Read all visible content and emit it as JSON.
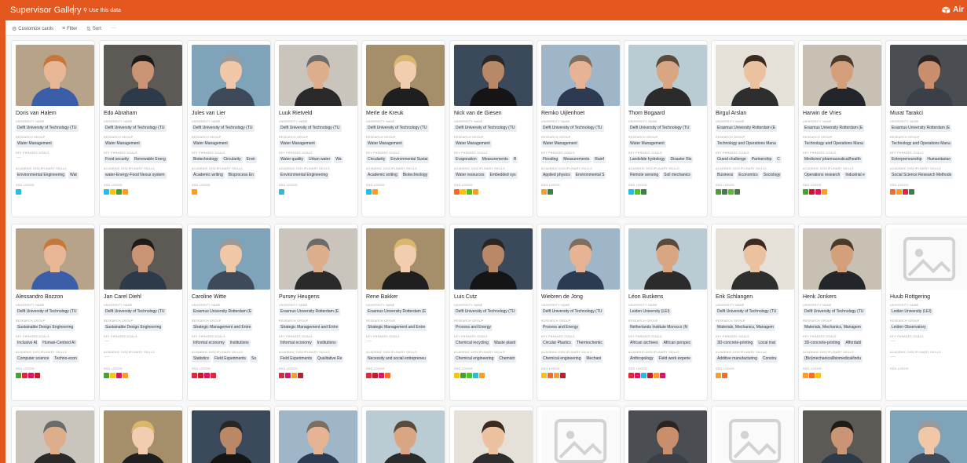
{
  "app": {
    "title": "Supervisor Gallery",
    "use_data": "Use this data",
    "brand": "Air"
  },
  "toolbar": {
    "customize": "Customize cards",
    "filter": "Filter",
    "sort": "Sort",
    "more": "···"
  },
  "labels": {
    "university": "University name",
    "research_group": "Research group",
    "key_phrases": "Key phrases goals",
    "skills": "Academic disciplinary skills",
    "sdg": "SDG logos"
  },
  "colors": {
    "brand": "#e4571f",
    "chip": "#e9eef5"
  },
  "cards": [
    {
      "name": "Doris van Halem",
      "university": "Delft University of Technology (TU",
      "group": "Water Management",
      "key_phrases": [],
      "skills": [
        "Environmental Engineering",
        "Wat"
      ],
      "sdgs": [
        "#26bde2"
      ]
    },
    {
      "name": "Edo Abraham",
      "university": "Delft University of Technology (TU",
      "group": "Water Management",
      "key_phrases": [
        "Food security",
        "Renewable Energ"
      ],
      "skills": [
        "water-Energy-Food Nexus system"
      ],
      "sdgs": [
        "#26bde2",
        "#fcc30b",
        "#4c9f38",
        "#fd9d24"
      ]
    },
    {
      "name": "Jules van Lier",
      "university": "Delft University of Technology (TU",
      "group": "Water Management",
      "key_phrases": [
        "Biotechnology",
        "Circularity",
        "Envir"
      ],
      "skills": [
        "Academic writing",
        "Bioprocess En"
      ],
      "sdgs": [
        "#fd9d24"
      ]
    },
    {
      "name": "Luuk Rietveld",
      "university": "Delft University of Technology (TU",
      "group": "Water Management",
      "key_phrases": [
        "Water quality",
        "Urban water",
        "Wa"
      ],
      "skills": [
        "Environmental Engineering"
      ],
      "sdgs": [
        "#26bde2"
      ]
    },
    {
      "name": "Merle de Kreuk",
      "university": "Delft University of Technology (TU",
      "group": "Water Management",
      "key_phrases": [
        "Circularity",
        "Environmental Sustai"
      ],
      "skills": [
        "Academic writing",
        "Biotechnology"
      ],
      "sdgs": [
        "#26bde2",
        "#fd9d24"
      ]
    },
    {
      "name": "Nick van de Giesen",
      "university": "Delft University of Technology (TU",
      "group": "Water Management",
      "key_phrases": [
        "Evaporation",
        "Measurements",
        "R"
      ],
      "skills": [
        "Water resources",
        "Embedded sys"
      ],
      "sdgs": [
        "#fd6925",
        "#fcc30b",
        "#56c02b",
        "#fd9d24"
      ]
    },
    {
      "name": "Remko Uijlenhoet",
      "university": "Delft University of Technology (TU",
      "group": "Water Management",
      "key_phrases": [
        "Flooding",
        "Measurements",
        "Rainf"
      ],
      "skills": [
        "Applied physics",
        "Environmental S"
      ],
      "sdgs": [
        "#fd9d24",
        "#3f7e44"
      ]
    },
    {
      "name": "Thom Bogaard",
      "university": "Delft University of Technology (TU",
      "group": "Water Management",
      "key_phrases": [
        "Landslide hydrology",
        "Disaster Ris"
      ],
      "skills": [
        "Remote sensing",
        "Soil mechanics"
      ],
      "sdgs": [
        "#26bde2",
        "#56c02b",
        "#3f7e44"
      ]
    },
    {
      "name": "Birgul Arslan",
      "university": "Erasmus University Rotterdam (E",
      "group": "Technology and Operations Mana",
      "key_phrases": [
        "Grand challenge",
        "Partnership",
        "C"
      ],
      "skills": [
        "Business",
        "Economics",
        "Sociology"
      ],
      "sdgs": [
        "#4c9f38",
        "#3f7e44",
        "#56c02b",
        "#3f7e44"
      ]
    },
    {
      "name": "Harwin de Vries",
      "university": "Erasmus University Rotterdam (E",
      "group": "Technology and Operations Mana",
      "key_phrases": [
        "Medicine/ pharmaceutical/health"
      ],
      "skills": [
        "Operations research",
        "Industrial e"
      ],
      "sdgs": [
        "#4c9f38",
        "#c5192d",
        "#dd1367",
        "#fd9d24"
      ]
    },
    {
      "name": "Murat Tarakci",
      "university": "Erasmus University Rotterdam (E",
      "group": "Technology and Operations Mana",
      "key_phrases": [
        "Entrepreneurship",
        "Humanitarian"
      ],
      "skills": [
        "Social Science Research Methods"
      ],
      "sdgs": [
        "#fd6925",
        "#fd9d24",
        "#e5243b",
        "#3f7e44"
      ]
    },
    {
      "name": "Alessandro Bozzon",
      "university": "Delft University of Technology (TU",
      "group": "Sustainable Design Engineering",
      "key_phrases": [
        "Inclusive AI",
        "Human-Centred AI"
      ],
      "skills": [
        "Computer science",
        "Techno-econ"
      ],
      "sdgs": [
        "#4c9f38",
        "#e5243b",
        "#dd1367",
        "#c5192d"
      ]
    },
    {
      "name": "Jan Carel Diehl",
      "university": "Delft University of Technology (TU",
      "group": "Sustainable Design Engineering",
      "key_phrases": [],
      "skills": [],
      "sdgs": [
        "#4c9f38",
        "#fcc30b",
        "#dd1367",
        "#fd9d24"
      ]
    },
    {
      "name": "Caroline Witte",
      "university": "Erasmus University Rotterdam (E",
      "group": "Strategic Management and Entre",
      "key_phrases": [
        "Informal economy",
        "Institutions"
      ],
      "skills": [
        "Statistics",
        "Field Experiments",
        "So"
      ],
      "sdgs": [
        "#e5243b",
        "#c5192d",
        "#dd1367",
        "#e5243b"
      ]
    },
    {
      "name": "Pursey Heugens",
      "university": "Erasmus University Rotterdam (E",
      "group": "Strategic Management and Entre",
      "key_phrases": [
        "Informal economy",
        "Institutions"
      ],
      "skills": [
        "Field Experiments",
        "Qualitative Re"
      ],
      "sdgs": [
        "#e5243b",
        "#dd1367",
        "#fd9d24",
        "#c5192d"
      ]
    },
    {
      "name": "Rene Bakker",
      "university": "Erasmus University Rotterdam (E",
      "group": "Strategic Management and Entre",
      "key_phrases": [],
      "skills": [
        "Necessity and social entrepreneu"
      ],
      "sdgs": [
        "#e5243b",
        "#c5192d",
        "#dd1367",
        "#fd6925"
      ]
    },
    {
      "name": "Luis Cutz",
      "university": "Delft University of Technology (TU",
      "group": "Process and Energy",
      "key_phrases": [
        "Chemical recycling",
        "Waste plasti"
      ],
      "skills": [
        "Chemical engineering",
        "Chemistr"
      ],
      "sdgs": [
        "#fcc30b",
        "#4c9f38",
        "#56c02b",
        "#26bde2",
        "#fd9d24"
      ]
    },
    {
      "name": "Wiebren de Jong",
      "university": "Delft University of Technology (TU",
      "group": "Process and Energy",
      "key_phrases": [
        "Circular Plastics",
        "Thermochemic"
      ],
      "skills": [
        "Chemical engineering",
        "Mechani"
      ],
      "sdgs": [
        "#fcc30b",
        "#fd6925",
        "#fd9d24",
        "#c5192d"
      ]
    },
    {
      "name": "Léon Buskens",
      "university": "Leiden University (LEI)",
      "group": "Netherlands Institute Morocco (N",
      "key_phrases": [
        "African archives",
        "African perspec"
      ],
      "skills": [
        "Anthropology",
        "Field work experie"
      ],
      "sdgs": [
        "#e5243b",
        "#dd1367",
        "#26bde2",
        "#c5192d",
        "#fd9d24",
        "#dd1367"
      ]
    },
    {
      "name": "Erik Schlangen",
      "university": "Delft University of Technology (TU",
      "group": "Materials, Mechanics, Managem",
      "key_phrases": [
        "3D-concrete-printing",
        "Local mat"
      ],
      "skills": [
        "Additive manufacturing",
        "Constru"
      ],
      "sdgs": [
        "#fd9d24",
        "#fd6925"
      ]
    },
    {
      "name": "Henk Jonkers",
      "university": "Delft University of Technology (TU",
      "group": "Materials, Mechanics, Managem",
      "key_phrases": [
        "3D-concrete-printing",
        "Affordabl"
      ],
      "skills": [
        "(Bio)mechanical/biomedical/indu"
      ],
      "sdgs": [
        "#fd9d24",
        "#fd6925",
        "#fcc30b"
      ]
    },
    {
      "name": "Huub Rottgering",
      "university": "Leiden University (LEI)",
      "group": "Leiden Observatory",
      "key_phrases": [],
      "skills": [],
      "sdgs": []
    }
  ]
}
